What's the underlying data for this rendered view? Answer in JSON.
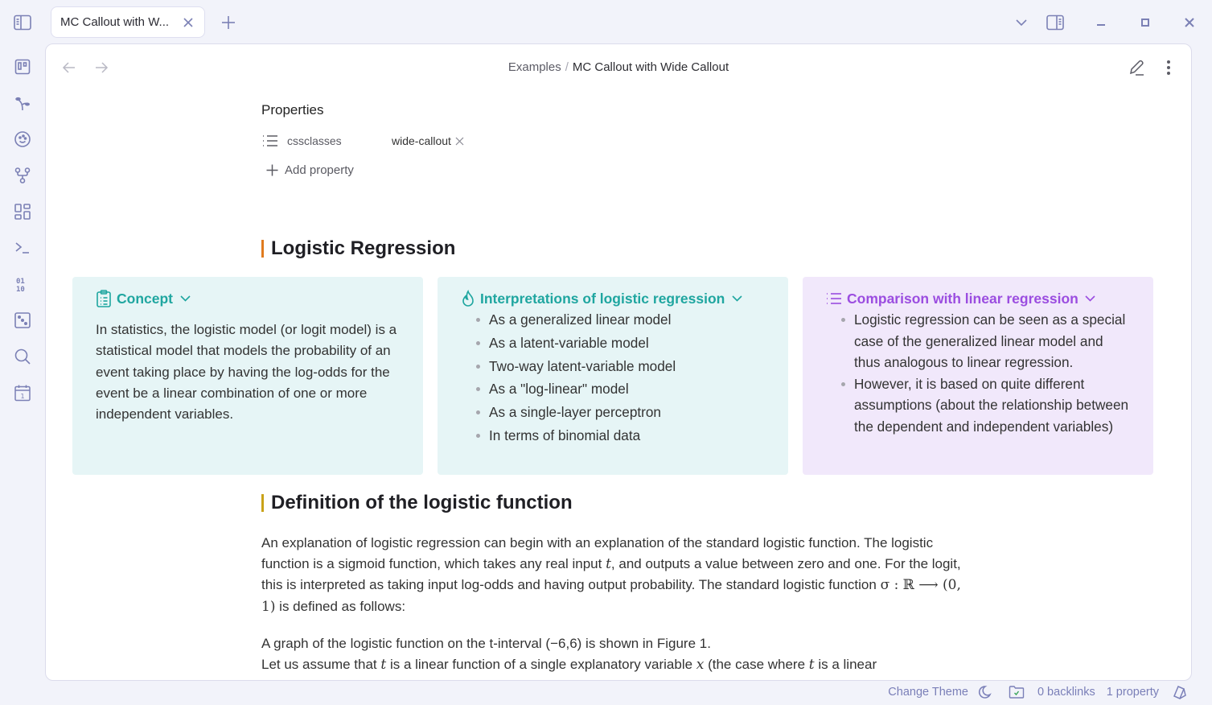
{
  "window": {
    "tab_title": "MC Callout with W...",
    "icons": {
      "sidebar_toggle": "sidebar-toggle-icon",
      "tab_close": "close-icon",
      "new_tab": "plus-icon",
      "tab_list": "chevron-down-icon",
      "right_sidebar": "right-sidebar-icon",
      "minimize": "minimize-icon",
      "maximize": "maximize-icon",
      "close": "close-icon"
    }
  },
  "ribbon": {
    "items": [
      {
        "name": "kanban",
        "icon": "kanban-icon"
      },
      {
        "name": "sprout",
        "icon": "sprout-icon"
      },
      {
        "name": "cookie",
        "icon": "cookie-icon"
      },
      {
        "name": "git-fork",
        "icon": "git-fork-icon"
      },
      {
        "name": "layout-dashboard",
        "icon": "dashboard-icon"
      },
      {
        "name": "terminal",
        "icon": "terminal-icon"
      },
      {
        "name": "binary",
        "icon": "binary-icon"
      },
      {
        "name": "dice",
        "icon": "dice-icon"
      },
      {
        "name": "search",
        "icon": "search-icon"
      },
      {
        "name": "calendar",
        "icon": "calendar-icon",
        "label": "1"
      }
    ]
  },
  "header": {
    "breadcrumb_parent": "Examples",
    "breadcrumb_sep": "/",
    "breadcrumb_current": "MC Callout with Wide Callout"
  },
  "properties": {
    "title": "Properties",
    "rows": [
      {
        "key": "cssclasses",
        "value": "wide-callout"
      }
    ],
    "add_label": "Add property"
  },
  "sections": {
    "heading_1": "Logistic Regression",
    "heading_1_color": "#e07b1f",
    "heading_2": "Definition of the logistic function",
    "heading_2_color": "#c9a218"
  },
  "callouts": [
    {
      "title": "Concept",
      "icon": "clipboard-list-icon",
      "color": "#1fa6a0",
      "body": "In statistics, the logistic model (or logit model) is a statistical model that models the probability of an event taking place by having the log-odds for the event be a linear combination of one or more independent variables."
    },
    {
      "title": "Interpretations of logistic regression",
      "icon": "flame-icon",
      "color": "#1fa6a0",
      "items": [
        "As a generalized linear model",
        "As a latent-variable model",
        "Two-way latent-variable model",
        "As a \"log-linear\" model",
        "As a single-layer perceptron",
        "In terms of binomial data"
      ]
    },
    {
      "title": "Comparison with linear regression",
      "icon": "list-icon",
      "color": "#9b4de0",
      "items": [
        "Logistic regression can be seen as a special case of the generalized linear model and thus analogous to linear regression.",
        "However, it is based on quite different assumptions (about the relationship between the dependent and independent variables)"
      ]
    }
  ],
  "paragraph_1": {
    "part_a": "An explanation of logistic regression can begin with an explanation of the standard logistic function. The logistic function is a sigmoid function, which takes any real input ",
    "math_t": "t",
    "part_b": ", and outputs a value between zero and one. For the logit, this is interpreted as taking input log-odds and having output probability. The standard logistic function ",
    "math_sigma": "σ : ℝ ⟶ (0, 1)",
    "part_c": " is defined as follows:"
  },
  "paragraph_2": {
    "line_1": "A graph of the logistic function on the t-interval (−6,6) is shown in Figure 1.",
    "part_a": "Let us assume that ",
    "math_t": "t",
    "part_b": " is a linear function of a single explanatory variable ",
    "math_x": "x",
    "part_c": " (the case where ",
    "math_t2": "t",
    "part_d": " is a linear"
  },
  "status_bar": {
    "change_theme": "Change Theme",
    "backlinks": "0 backlinks",
    "properties": "1 property"
  }
}
